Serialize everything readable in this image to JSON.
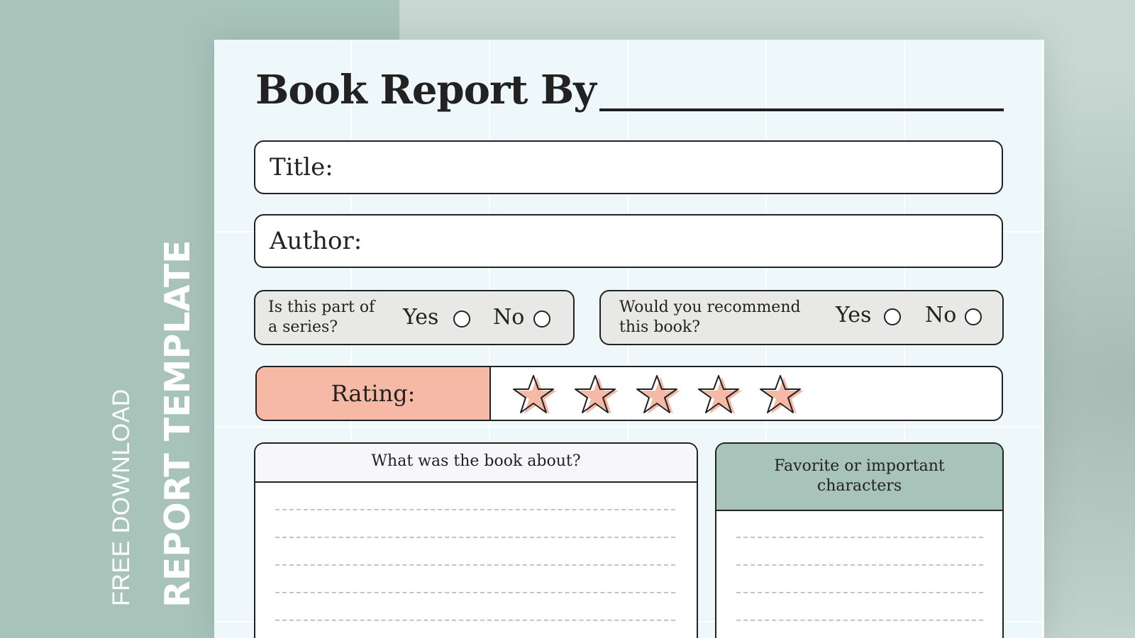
{
  "side_banner": {
    "line1": "FREE DOWNLOAD",
    "line2": "REPORT TEMPLATE"
  },
  "report": {
    "heading": "Book Report By",
    "title_label": "Title:",
    "author_label": "Author:",
    "series_question": "Is this part of\na series?",
    "recommend_question": "Would you recommend\nthis book?",
    "yes_label": "Yes",
    "no_label": "No",
    "rating_label": "Rating:",
    "star_count": 5,
    "about_heading": "What was the book about?",
    "characters_heading": "Favorite or important\ncharacters"
  },
  "colors": {
    "accent_salmon": "#f6b9a6",
    "accent_sage": "#a8c3ba",
    "sheet": "#eef7fa"
  }
}
